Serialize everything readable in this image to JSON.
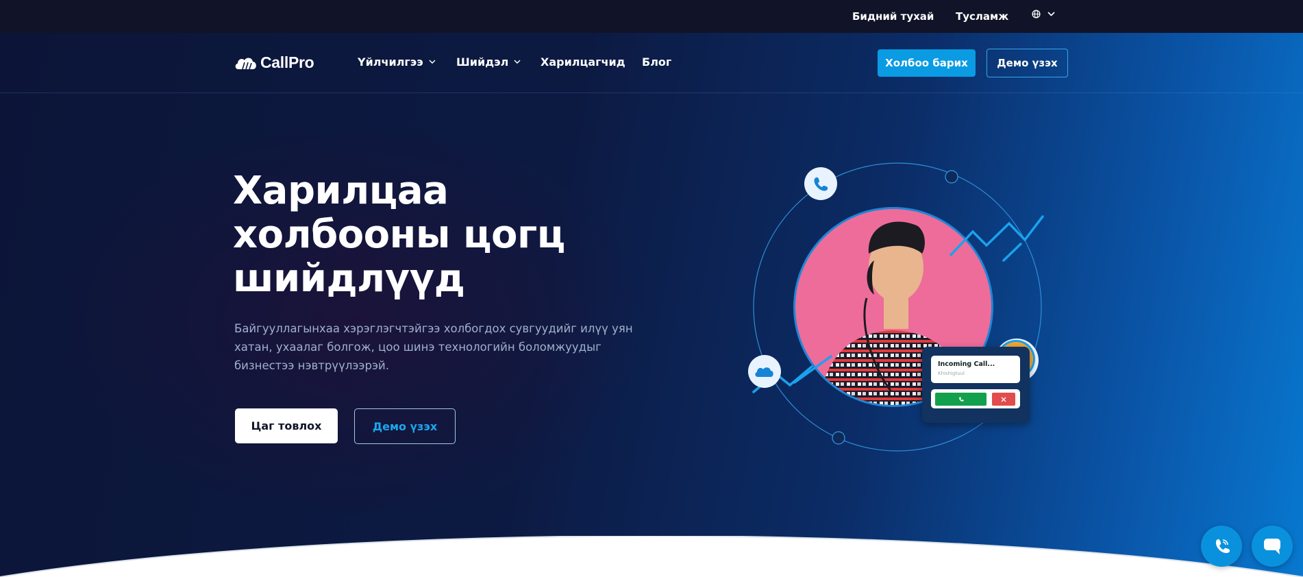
{
  "topbar": {
    "about": "Бидний тухай",
    "help": "Тусламж",
    "language_icon": "globe-icon"
  },
  "brand": {
    "name": "CallPro",
    "logo_icon": "cloud-icon"
  },
  "nav": {
    "items": [
      {
        "label": "Үйлчилгээ",
        "has_dropdown": true
      },
      {
        "label": "Шийдэл",
        "has_dropdown": true
      },
      {
        "label": "Харилцагчид",
        "has_dropdown": false
      },
      {
        "label": "Блог",
        "has_dropdown": false
      }
    ],
    "contact_button": "Холбоо барих",
    "demo_button": "Демо үзэх"
  },
  "hero": {
    "title_lines": [
      "Харилцаа",
      "холбооны цогц",
      "шийдлүүд"
    ],
    "subtitle": "Байгууллагынхаа хэрэглэгчтэйгээ холбогдох сувгуудийг илүү уян хатан, ухаалаг болгож, цоо шинэ технологийн боломжуудыг бизнестээ нэвтрүүлээрэй.",
    "primary_button": "Цаг товлох",
    "secondary_button": "Демо үзэх"
  },
  "illustration": {
    "call_card": {
      "title": "Incoming Call...",
      "caller": "Khishigtuul"
    }
  },
  "floating": {
    "call_fab_icon": "phone-icon",
    "chat_fab_icon": "chat-icon"
  },
  "colors": {
    "accent": "#0a9be3",
    "topbar": "#111428",
    "hero_dark": "#0c1538",
    "hero_light": "#0878cf",
    "accept": "#13a04d",
    "decline": "#e24c4c"
  }
}
